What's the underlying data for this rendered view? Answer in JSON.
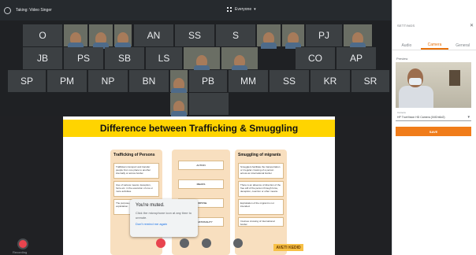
{
  "topbar": {
    "title": "Taking: Video Singer",
    "layout_label": "Everyone",
    "people_count": "2"
  },
  "grid": {
    "row1": [
      "O",
      "",
      "",
      "AN",
      "SS",
      "S",
      "",
      "",
      "PJ",
      ""
    ],
    "row2": [
      "JB",
      "PS",
      "SB",
      "LS",
      "",
      "",
      "CO",
      "AP"
    ],
    "row3": [
      "SP",
      "PM",
      "NP",
      "BN",
      "",
      "PB",
      "MM",
      "SS",
      "KR",
      "SR"
    ]
  },
  "slide": {
    "title": "Difference between Trafficking & Smuggling",
    "left_title": "Trafficking of Persons",
    "right_title": "Smuggling of migrants",
    "middle_rows": [
      "ACTION",
      "MEANS",
      "PURPOSE",
      "TRANSNATIONALITY"
    ],
    "left_boxes": [
      "Traffickers transport and transfer people from one place to another internally or across border.",
      "Use of various means: deception, force etc. in the execution of one or more activities.",
      "The purpose of trafficking is exploitation."
    ],
    "right_boxes": [
      "Smugglers facilitate the transportation or irregular crossing of a person across an international border.",
      "There is an absence of direction of the free will of the person through force, deception, coercion or other means.",
      "Exploitation of the migrant is not intended.",
      "Involves crossing of international border."
    ],
    "stamp": "AVETI KEDID"
  },
  "toast": {
    "title": "You're muted.",
    "body": "Click the microphone icon at any time to unmute.",
    "link": "Don't remind me again"
  },
  "bottom": {
    "record_label": "Recording"
  },
  "settings": {
    "header": "SETTINGS",
    "tabs": [
      "Audio",
      "Camera",
      "General"
    ],
    "active_tab": "Camera",
    "preview_label": "Preview",
    "camera_label": "Camera",
    "camera_value": "HP TrueVision HD Camera (04f2:b6d2)",
    "save_label": "SAVE"
  },
  "colors": {
    "accent": "#f07c1a",
    "slide_header": "#ffd400",
    "mic_muted": "#e8444e"
  }
}
